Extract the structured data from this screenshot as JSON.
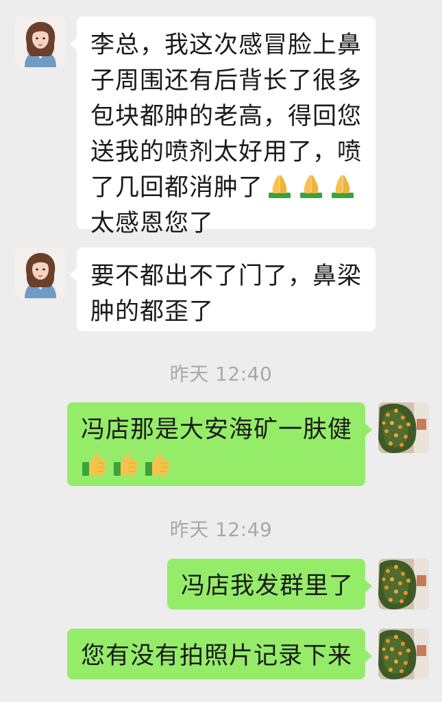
{
  "messages": [
    {
      "side": "incoming",
      "lines": [
        "李总，我这次感冒脸上鼻",
        "子周围还有后背长了很多",
        "包块都肿的老高，得回您",
        "送我的喷剂太好用了，喷",
        "了几回都消肿了",
        "太感恩您了"
      ],
      "emoji_after_line5": [
        "folded-hands",
        "folded-hands",
        "folded-hands"
      ]
    },
    {
      "side": "incoming",
      "lines": [
        "要不都出不了门了，鼻梁",
        "肿的都歪了"
      ]
    },
    {
      "side": "outgoing",
      "lines": [
        "冯店那是大安海矿一肤健"
      ],
      "emoji_line": [
        "thumbs-up",
        "thumbs-up",
        "thumbs-up"
      ]
    },
    {
      "side": "outgoing",
      "lines": [
        "冯店我发群里了"
      ]
    },
    {
      "side": "outgoing",
      "lines": [
        "您有没有拍照片记录下来"
      ]
    }
  ],
  "timestamps": [
    "昨天 12:40",
    "昨天 12:49"
  ],
  "colors": {
    "background": "#ededed",
    "incoming_bubble": "#ffffff",
    "outgoing_bubble": "#95ec69",
    "timestamp_text": "#a8a8a8"
  }
}
